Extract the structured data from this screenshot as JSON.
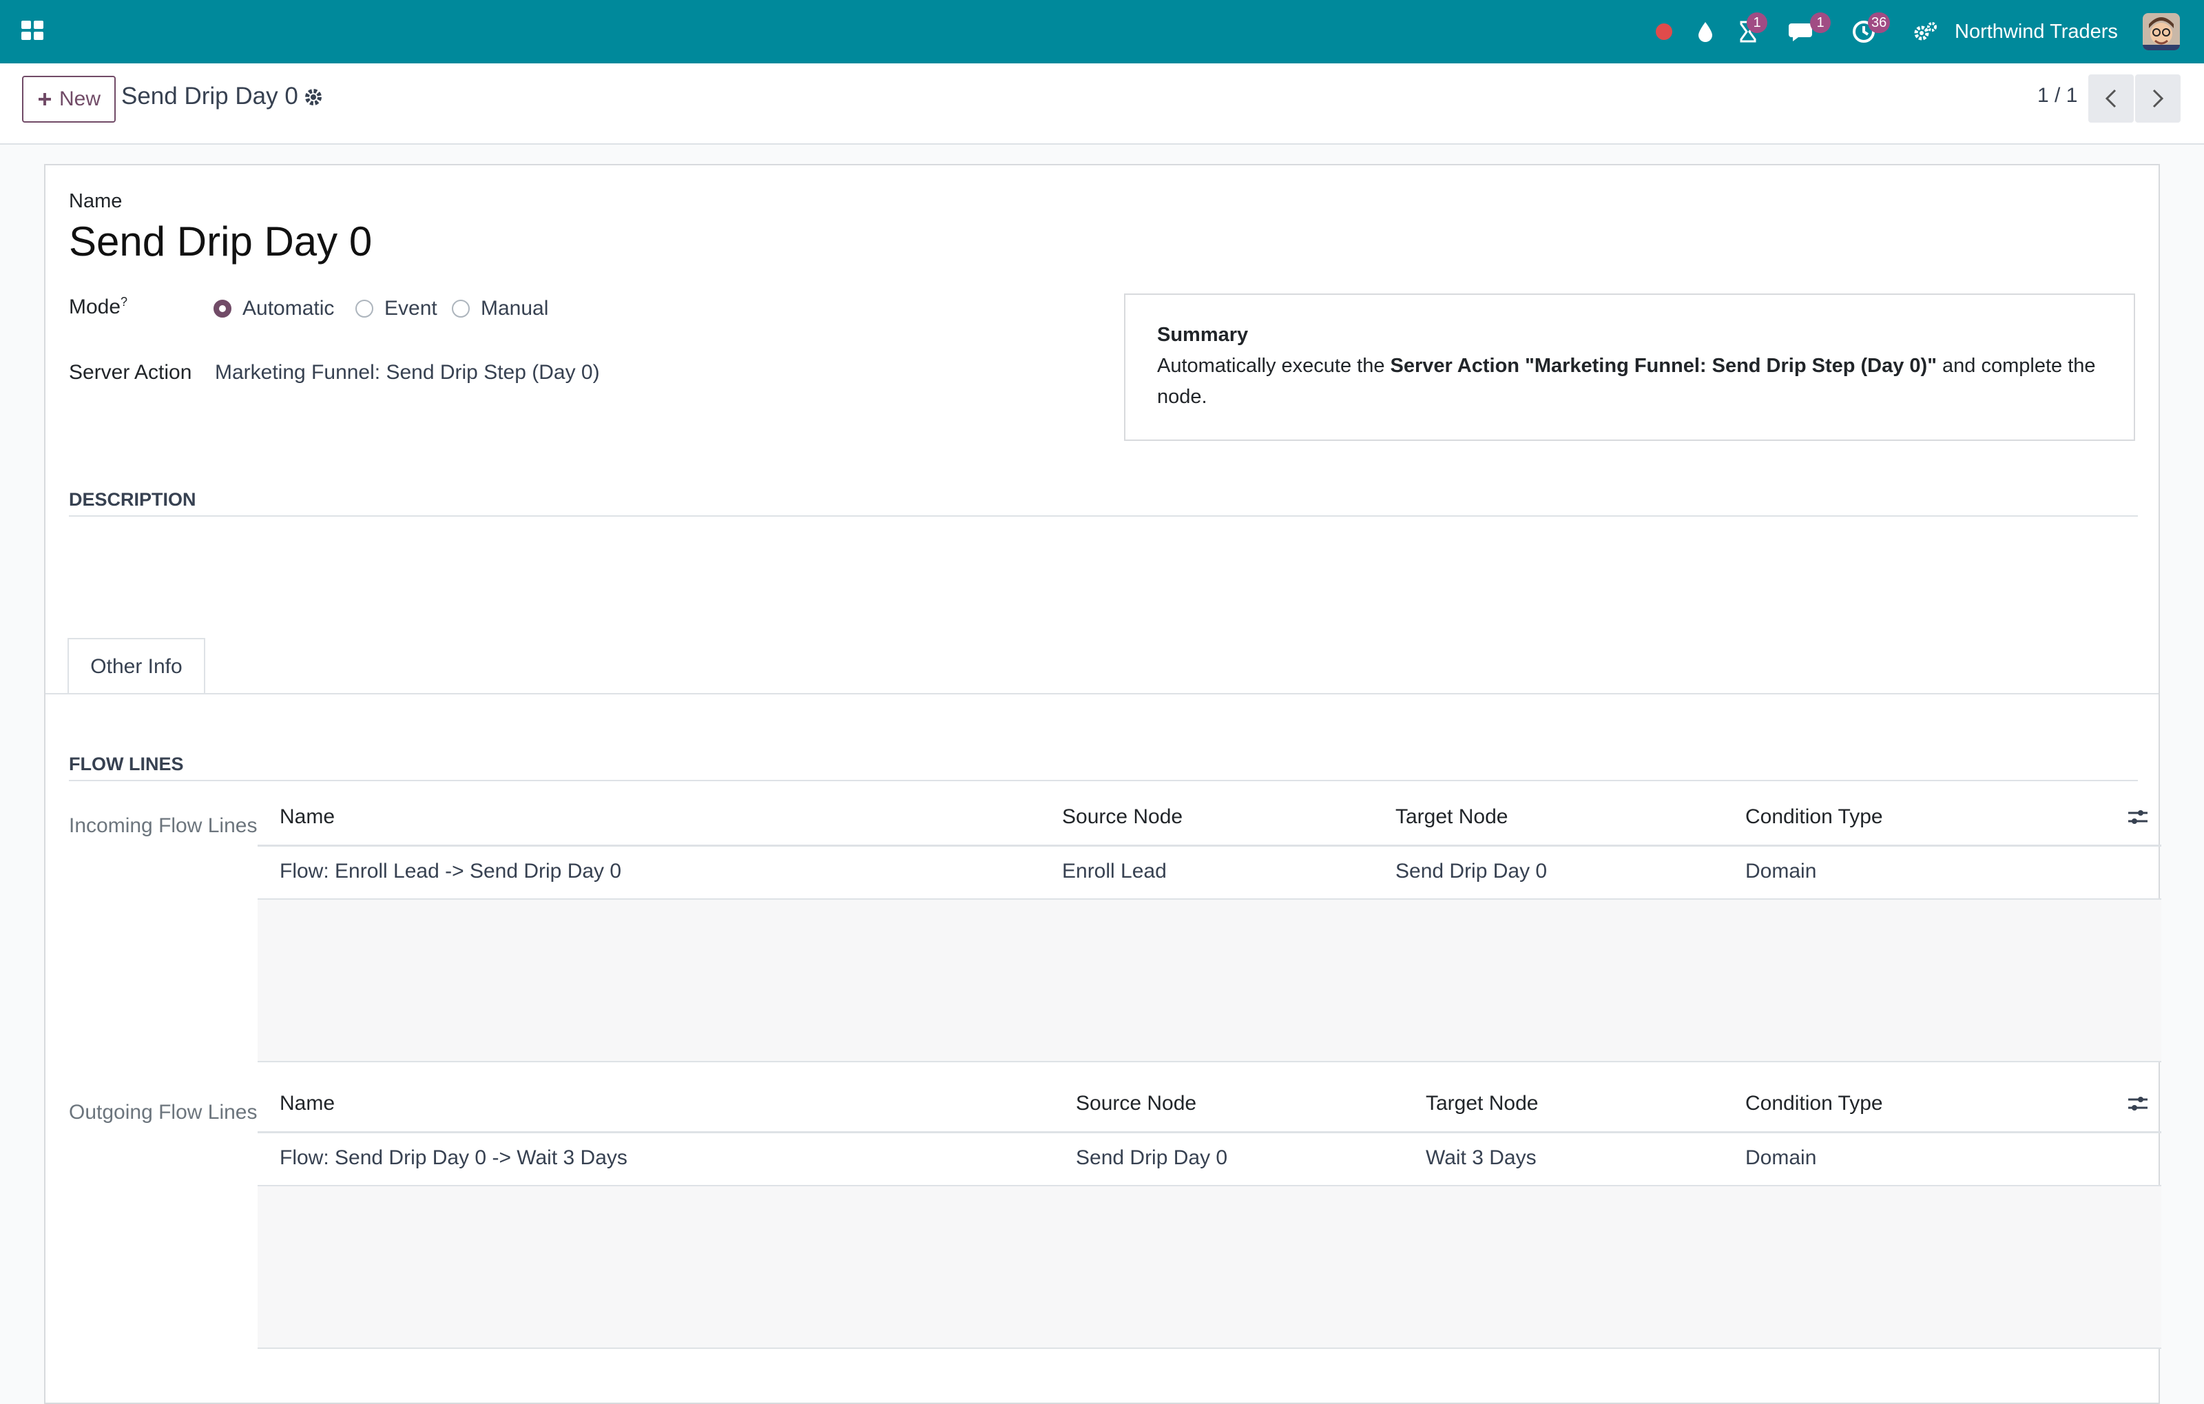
{
  "topbar": {
    "company": "Northwind Traders",
    "badges": {
      "activity": "1",
      "messages": "1",
      "clock": "36"
    },
    "colors": {
      "bar": "#00899b",
      "badge": "#a14c84",
      "record_dot": "#e04b4b"
    },
    "icons": [
      "apps-grid-icon",
      "record-dot-icon",
      "droplet-icon",
      "hourglass-icon",
      "chat-icon",
      "clock-icon",
      "gears-icon"
    ]
  },
  "control_panel": {
    "new_label": "New",
    "breadcrumb": "Send Drip Day 0",
    "pager": "1 / 1"
  },
  "form": {
    "name_label": "Name",
    "name_value": "Send Drip Day 0",
    "mode_label": "Mode",
    "mode_help": "?",
    "mode_options": [
      "Automatic",
      "Event",
      "Manual"
    ],
    "mode_selected": "Automatic",
    "server_action_label": "Server Action",
    "server_action_value": "Marketing Funnel: Send Drip Step (Day 0)",
    "summary": {
      "title": "Summary",
      "text_pre": "Automatically execute the ",
      "text_bold": "Server Action \"Marketing Funnel: Send Drip Step (Day 0)\"",
      "text_post": " and complete the node."
    },
    "description_head": "DESCRIPTION",
    "tabs": [
      "Other Info"
    ],
    "flow_lines_head": "FLOW LINES",
    "incoming": {
      "label": "Incoming Flow Lines",
      "columns": [
        "Name",
        "Source Node",
        "Target Node",
        "Condition Type"
      ],
      "rows": [
        [
          "Flow: Enroll Lead -> Send Drip Day 0",
          "Enroll Lead",
          "Send Drip Day 0",
          "Domain"
        ]
      ]
    },
    "outgoing": {
      "label": "Outgoing Flow Lines",
      "columns": [
        "Name",
        "Source Node",
        "Target Node",
        "Condition Type"
      ],
      "rows": [
        [
          "Flow: Send Drip Day 0 -> Wait 3 Days",
          "Send Drip Day 0",
          "Wait 3 Days",
          "Domain"
        ]
      ]
    }
  }
}
